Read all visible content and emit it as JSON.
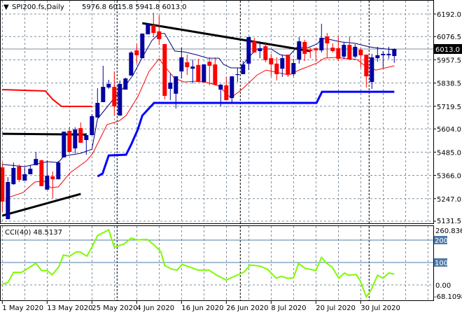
{
  "header": {
    "arrow": "▼",
    "symbol": "SPI200.fs,Daily",
    "ohlc": "5976.8 6015.8 5941.8 6013.0"
  },
  "cci_label": "CCI(40) 48.5137",
  "current_price_label": "6013.0",
  "colors": {
    "bull": "#0000a0",
    "bear": "#ff0000",
    "ma_fast": "#000080",
    "ma_slow": "#ff0000",
    "stop_red": "#ff0000",
    "stop_blue": "#0000ff",
    "trend": "#000000",
    "cci": "#7cfc00",
    "level": "#4f7aa8",
    "grid": "#8090a0"
  },
  "chart_data": [
    {
      "type": "candlestick",
      "title": "SPI200.fs,Daily",
      "ylim": [
        5131.5,
        6192.0
      ],
      "y_ticks": [
        "6192.0",
        "6076.5",
        "5957.5",
        "5838.5",
        "5719.5",
        "5604.0",
        "5485.0",
        "5366.0",
        "5247.0",
        "5131.5"
      ],
      "y_tick_values": [
        6192.0,
        6076.5,
        5957.5,
        5838.5,
        5719.5,
        5604.0,
        5485.0,
        5366.0,
        5247.0,
        5131.5
      ],
      "current_price": 6013.0,
      "x_labels": [
        {
          "bar": 0,
          "text": "1 May 2020"
        },
        {
          "bar": 8,
          "text": "13 May 2020"
        },
        {
          "bar": 16,
          "text": "25 May 2020"
        },
        {
          "bar": 24,
          "text": "4 Jun 2020"
        },
        {
          "bar": 32,
          "text": "16 Jun 2020"
        },
        {
          "bar": 40,
          "text": "26 Jun 2020"
        },
        {
          "bar": 48,
          "text": "8 Jul 2020"
        },
        {
          "bar": 56,
          "text": "20 Jul 2020"
        },
        {
          "bar": 64,
          "text": "30 Jul 2020"
        }
      ],
      "period_separators": [
        21,
        43,
        66
      ],
      "ohlc": [
        [
          5407,
          5432,
          5182,
          5232
        ],
        [
          5142,
          5357,
          5142,
          5332
        ],
        [
          5321,
          5432,
          5318,
          5404
        ],
        [
          5411,
          5422,
          5332,
          5343
        ],
        [
          5339,
          5407,
          5339,
          5372
        ],
        [
          5372,
          5418,
          5372,
          5400
        ],
        [
          5418,
          5486,
          5418,
          5450
        ],
        [
          5443,
          5447,
          5311,
          5311
        ],
        [
          5293,
          5443,
          5293,
          5364
        ],
        [
          5361,
          5386,
          5250,
          5346
        ],
        [
          5346,
          5440,
          5346,
          5432
        ],
        [
          5458,
          5590,
          5458,
          5590
        ],
        [
          5594,
          5615,
          5486,
          5486
        ],
        [
          5504,
          5612,
          5479,
          5601
        ],
        [
          5608,
          5637,
          5533,
          5533
        ],
        [
          5547,
          5583,
          5472,
          5572
        ],
        [
          5572,
          5680,
          5572,
          5669
        ],
        [
          5662,
          5812,
          5662,
          5737
        ],
        [
          5741,
          5927,
          5741,
          5819
        ],
        [
          5816,
          5855,
          5809,
          5834
        ],
        [
          5819,
          5898,
          5672,
          5719
        ],
        [
          5672,
          5852,
          5672,
          5834
        ],
        [
          5805,
          5866,
          5805,
          5862
        ],
        [
          5877,
          6002,
          5877,
          5995
        ],
        [
          6006,
          6038,
          5938,
          5981
        ],
        [
          5966,
          6092,
          5966,
          6092
        ],
        [
          6088,
          6142,
          6088,
          6142
        ],
        [
          6135,
          6199,
          6074,
          6095
        ],
        [
          6103,
          6185,
          6034,
          6063
        ],
        [
          6038,
          6040,
          5755,
          5773
        ],
        [
          5809,
          5887,
          5751,
          5841
        ],
        [
          5784,
          5873,
          5708,
          5873
        ],
        [
          5898,
          6020,
          5862,
          5970
        ],
        [
          5945,
          5984,
          5880,
          5920
        ],
        [
          5912,
          5959,
          5837,
          5923
        ],
        [
          5931,
          5963,
          5844,
          5844
        ],
        [
          5844,
          5934,
          5844,
          5934
        ],
        [
          5948,
          5970,
          5827,
          5927
        ],
        [
          5934,
          5970,
          5830,
          5830
        ],
        [
          5805,
          5834,
          5719,
          5830
        ],
        [
          5827,
          5870,
          5751,
          5751
        ],
        [
          5762,
          5873,
          5737,
          5873
        ],
        [
          5880,
          5916,
          5844,
          5884
        ],
        [
          5884,
          5952,
          5884,
          5934
        ],
        [
          5938,
          6074,
          5905,
          6074
        ],
        [
          6052,
          6070,
          5995,
          5995
        ],
        [
          6002,
          6052,
          5966,
          6017
        ],
        [
          6027,
          6049,
          5945,
          5956
        ],
        [
          5966,
          5988,
          5873,
          5934
        ],
        [
          5938,
          5970,
          5852,
          5884
        ],
        [
          5912,
          5984,
          5870,
          5966
        ],
        [
          5984,
          5984,
          5870,
          5884
        ],
        [
          5884,
          5963,
          5873,
          5941
        ],
        [
          5959,
          6074,
          5938,
          6052
        ],
        [
          6049,
          6060,
          5952,
          5988
        ],
        [
          6009,
          6020,
          5966,
          6002
        ],
        [
          6017,
          6017,
          5948,
          6006
        ],
        [
          6006,
          6142,
          5995,
          6070
        ],
        [
          6077,
          6095,
          5966,
          6042
        ],
        [
          6020,
          6042,
          5995,
          6002
        ],
        [
          6017,
          6077,
          5952,
          5963
        ],
        [
          5974,
          6049,
          5959,
          6034
        ],
        [
          6034,
          6077,
          5959,
          5959
        ],
        [
          5974,
          6038,
          5966,
          6024
        ],
        [
          6009,
          6017,
          5916,
          5981
        ],
        [
          5984,
          5984,
          5816,
          5873
        ],
        [
          5844,
          5988,
          5809,
          5970
        ],
        [
          5966,
          6024,
          5948,
          5981
        ],
        [
          5981,
          6002,
          5916,
          5988
        ],
        [
          5981,
          6024,
          5963,
          5988
        ],
        [
          5976.8,
          6015.8,
          5941.8,
          6013.0
        ]
      ],
      "overlays": [
        {
          "name": "ma-fast",
          "points": [
            [
              0,
              5422
            ],
            [
              4,
              5411
            ],
            [
              8,
              5436
            ],
            [
              10,
              5432
            ],
            [
              11,
              5465
            ],
            [
              14,
              5479
            ],
            [
              16,
              5500
            ],
            [
              17,
              5655
            ],
            [
              20,
              5762
            ],
            [
              21.7,
              5816
            ],
            [
              23.3,
              5877
            ],
            [
              25,
              5970
            ],
            [
              26.7,
              6056
            ],
            [
              28,
              6092
            ],
            [
              29,
              6092
            ],
            [
              30.8,
              6002
            ],
            [
              32.5,
              5998
            ],
            [
              34.6,
              5984
            ],
            [
              36.7,
              5966
            ],
            [
              38.7,
              5966
            ],
            [
              39.5,
              5934
            ],
            [
              40.8,
              5916
            ],
            [
              42.5,
              5916
            ],
            [
              44.2,
              5977
            ],
            [
              45.5,
              6013
            ],
            [
              48,
              6013
            ],
            [
              49.6,
              5984
            ],
            [
              51.2,
              5977
            ],
            [
              52.5,
              6020
            ],
            [
              54.6,
              6020
            ],
            [
              56.2,
              6038
            ],
            [
              57.1,
              6067
            ],
            [
              58.7,
              6060
            ],
            [
              60.5,
              6049
            ],
            [
              63,
              6042
            ],
            [
              65.5,
              6024
            ],
            [
              67.1,
              6017
            ],
            [
              70,
              6009
            ]
          ]
        },
        {
          "name": "ma-slow",
          "points": [
            [
              0.6,
              5232
            ],
            [
              0.8,
              5250
            ],
            [
              3.7,
              5278
            ],
            [
              5.8,
              5332
            ],
            [
              7.5,
              5336
            ],
            [
              8.6,
              5303
            ],
            [
              10,
              5307
            ],
            [
              12.1,
              5379
            ],
            [
              15,
              5440
            ],
            [
              16.1,
              5476
            ],
            [
              18.7,
              5626
            ],
            [
              20.8,
              5644
            ],
            [
              22.1,
              5672
            ],
            [
              24.2,
              5769
            ],
            [
              26.2,
              5898
            ],
            [
              28,
              5963
            ],
            [
              29,
              5923
            ],
            [
              30.8,
              5862
            ],
            [
              32.5,
              5844
            ],
            [
              34.6,
              5848
            ],
            [
              36.7,
              5841
            ],
            [
              38.7,
              5823
            ],
            [
              40.8,
              5762
            ],
            [
              42.9,
              5809
            ],
            [
              45.5,
              5880
            ],
            [
              47.1,
              5905
            ],
            [
              51.2,
              5880
            ],
            [
              53,
              5905
            ],
            [
              56.2,
              5941
            ],
            [
              57.5,
              5966
            ],
            [
              59.6,
              5970
            ],
            [
              63.3,
              5959
            ],
            [
              64.6,
              5931
            ],
            [
              66.7,
              5905
            ],
            [
              70,
              5927
            ]
          ]
        },
        {
          "name": "stop-red",
          "points": [
            [
              0,
              5805
            ],
            [
              7.7,
              5798
            ],
            [
              9,
              5755
            ],
            [
              10.6,
              5719
            ],
            [
              16.1,
              5719
            ]
          ]
        },
        {
          "name": "stop-blue",
          "points": [
            [
              17,
              5361
            ],
            [
              17.9,
              5375
            ],
            [
              19,
              5468
            ],
            [
              22.1,
              5472
            ],
            [
              23,
              5523
            ],
            [
              24.2,
              5601
            ],
            [
              25,
              5672
            ],
            [
              27.1,
              5737
            ],
            [
              56.1,
              5737
            ],
            [
              57.1,
              5794
            ],
            [
              70,
              5794
            ]
          ]
        },
        {
          "name": "trend-resistance",
          "points": [
            [
              25,
              6145
            ],
            [
              55,
              6002
            ]
          ]
        },
        {
          "name": "trend-support",
          "points": [
            [
              0,
              5160
            ],
            [
              14,
              5271
            ]
          ]
        },
        {
          "name": "trend-horizontal",
          "points": [
            [
              0,
              5579
            ],
            [
              15,
              5575
            ]
          ]
        }
      ]
    },
    {
      "type": "line",
      "title": "CCI(40)",
      "ylim": [
        -68.1098,
        260.8362
      ],
      "y_ticks": [
        "260.8362",
        "200",
        "100",
        "0.00",
        "-68.1098"
      ],
      "levels": [
        200,
        100
      ],
      "series": [
        {
          "name": "CCI(40)",
          "points": [
            [
              0,
              3
            ],
            [
              1,
              11
            ],
            [
              2,
              56
            ],
            [
              3.4,
              56
            ],
            [
              4.1,
              66
            ],
            [
              6,
              97
            ],
            [
              7,
              64
            ],
            [
              8,
              64
            ],
            [
              8.9,
              45
            ],
            [
              10.1,
              81
            ],
            [
              10.9,
              133
            ],
            [
              12,
              128
            ],
            [
              13.2,
              147
            ],
            [
              13.9,
              147
            ],
            [
              15.1,
              128
            ],
            [
              16.1,
              173
            ],
            [
              17,
              220
            ],
            [
              19,
              246
            ],
            [
              20,
              168
            ],
            [
              21.8,
              183
            ],
            [
              23,
              209
            ],
            [
              24,
              201
            ],
            [
              25.9,
              203
            ],
            [
              27.1,
              178
            ],
            [
              28.3,
              149
            ],
            [
              29,
              87
            ],
            [
              30.2,
              71
            ],
            [
              31.2,
              66
            ],
            [
              32.1,
              92
            ],
            [
              35,
              66
            ],
            [
              36.9,
              66
            ],
            [
              38.3,
              43
            ],
            [
              40,
              22
            ],
            [
              41.7,
              41
            ],
            [
              43.1,
              56
            ],
            [
              44.3,
              89
            ],
            [
              46,
              84
            ],
            [
              47.4,
              69
            ],
            [
              48.9,
              30
            ],
            [
              49.8,
              38
            ],
            [
              51,
              29
            ],
            [
              52,
              32
            ],
            [
              52.9,
              95
            ],
            [
              54.1,
              74
            ],
            [
              56,
              64
            ],
            [
              57,
              123
            ],
            [
              57.9,
              97
            ],
            [
              58.9,
              79
            ],
            [
              60.1,
              30
            ],
            [
              61.1,
              53
            ],
            [
              61.8,
              43
            ],
            [
              63.2,
              46
            ],
            [
              63.9,
              19
            ],
            [
              65,
              -53
            ],
            [
              65.8,
              -25
            ],
            [
              67,
              43
            ],
            [
              68,
              30
            ],
            [
              69,
              53
            ],
            [
              70,
              48.5
            ]
          ]
        }
      ]
    }
  ]
}
